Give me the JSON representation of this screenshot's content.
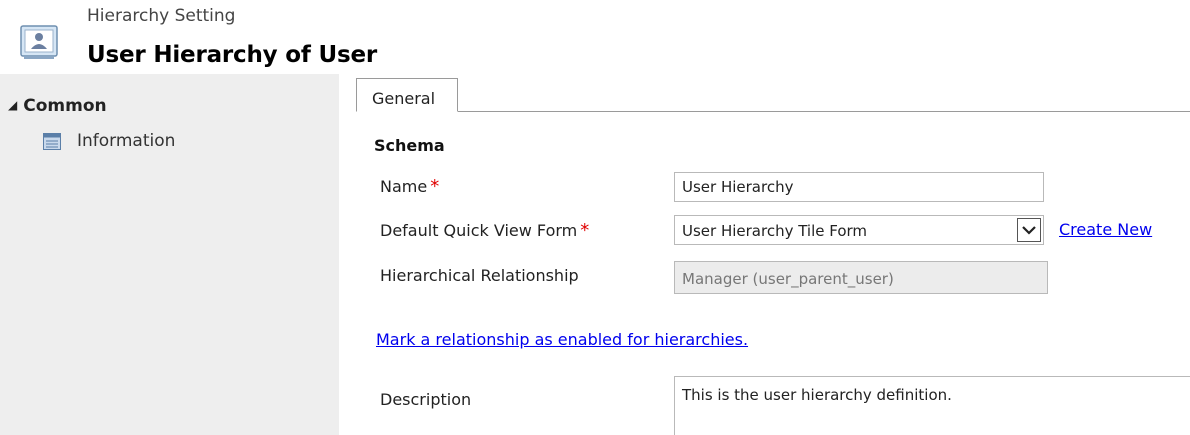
{
  "header": {
    "subtitle": "Hierarchy Setting",
    "title": "User Hierarchy of User"
  },
  "nav": {
    "group_label": "Common",
    "group_toggle": "◢",
    "items": [
      {
        "label": "Information",
        "icon": "document-icon"
      }
    ]
  },
  "tabs": [
    {
      "label": "General"
    }
  ],
  "section": {
    "title": "Schema"
  },
  "fields": {
    "name": {
      "label": "Name",
      "required": "*",
      "value": "User Hierarchy"
    },
    "quick_view": {
      "label": "Default Quick View Form",
      "required": "*",
      "value": "User Hierarchy Tile Form",
      "create_new": "Create New"
    },
    "relationship": {
      "label": "Hierarchical Relationship",
      "value": "Manager (user_parent_user)"
    },
    "mark_link": "Mark a relationship as enabled for hierarchies.",
    "description": {
      "label": "Description",
      "value": "This is the user hierarchy definition."
    }
  },
  "colors": {
    "required": "#e00000",
    "link": "#0000ee",
    "nav_bg": "#eeeeee"
  }
}
